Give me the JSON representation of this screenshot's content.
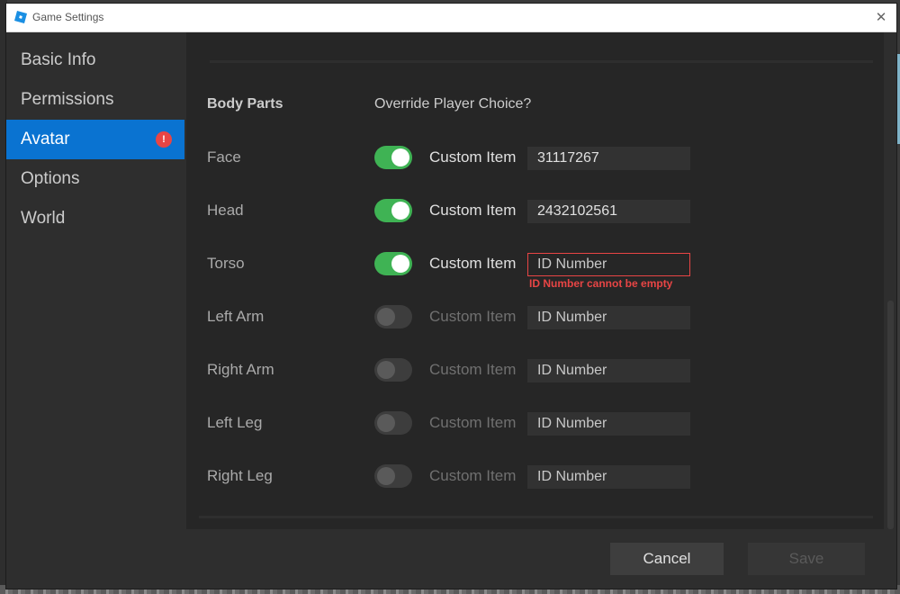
{
  "window": {
    "title": "Game Settings",
    "close_glyph": "✕"
  },
  "sidebar": {
    "items": [
      {
        "label": "Basic Info",
        "active": false
      },
      {
        "label": "Permissions",
        "active": false
      },
      {
        "label": "Avatar",
        "active": true,
        "badge": "!"
      },
      {
        "label": "Options",
        "active": false
      },
      {
        "label": "World",
        "active": false
      }
    ]
  },
  "avatar": {
    "body_parts_header": "Body Parts",
    "override_header": "Override Player Choice?",
    "custom_item_label": "Custom Item",
    "rows": [
      {
        "label": "Face",
        "override": true,
        "id_value": "31117267",
        "placeholder": false
      },
      {
        "label": "Head",
        "override": true,
        "id_value": "2432102561",
        "placeholder": false
      },
      {
        "label": "Torso",
        "override": true,
        "id_value": "ID Number",
        "placeholder": true,
        "error": "ID Number cannot be empty"
      },
      {
        "label": "Left Arm",
        "override": false,
        "id_value": "ID Number",
        "placeholder": true
      },
      {
        "label": "Right Arm",
        "override": false,
        "id_value": "ID Number",
        "placeholder": true
      },
      {
        "label": "Left Leg",
        "override": false,
        "id_value": "ID Number",
        "placeholder": true
      },
      {
        "label": "Right Leg",
        "override": false,
        "id_value": "ID Number",
        "placeholder": true
      }
    ]
  },
  "footer": {
    "cancel_label": "Cancel",
    "save_label": "Save",
    "save_enabled": false
  },
  "colors": {
    "accent": "#0a73d1",
    "toggle_on": "#3fb354",
    "error": "#e84545"
  }
}
